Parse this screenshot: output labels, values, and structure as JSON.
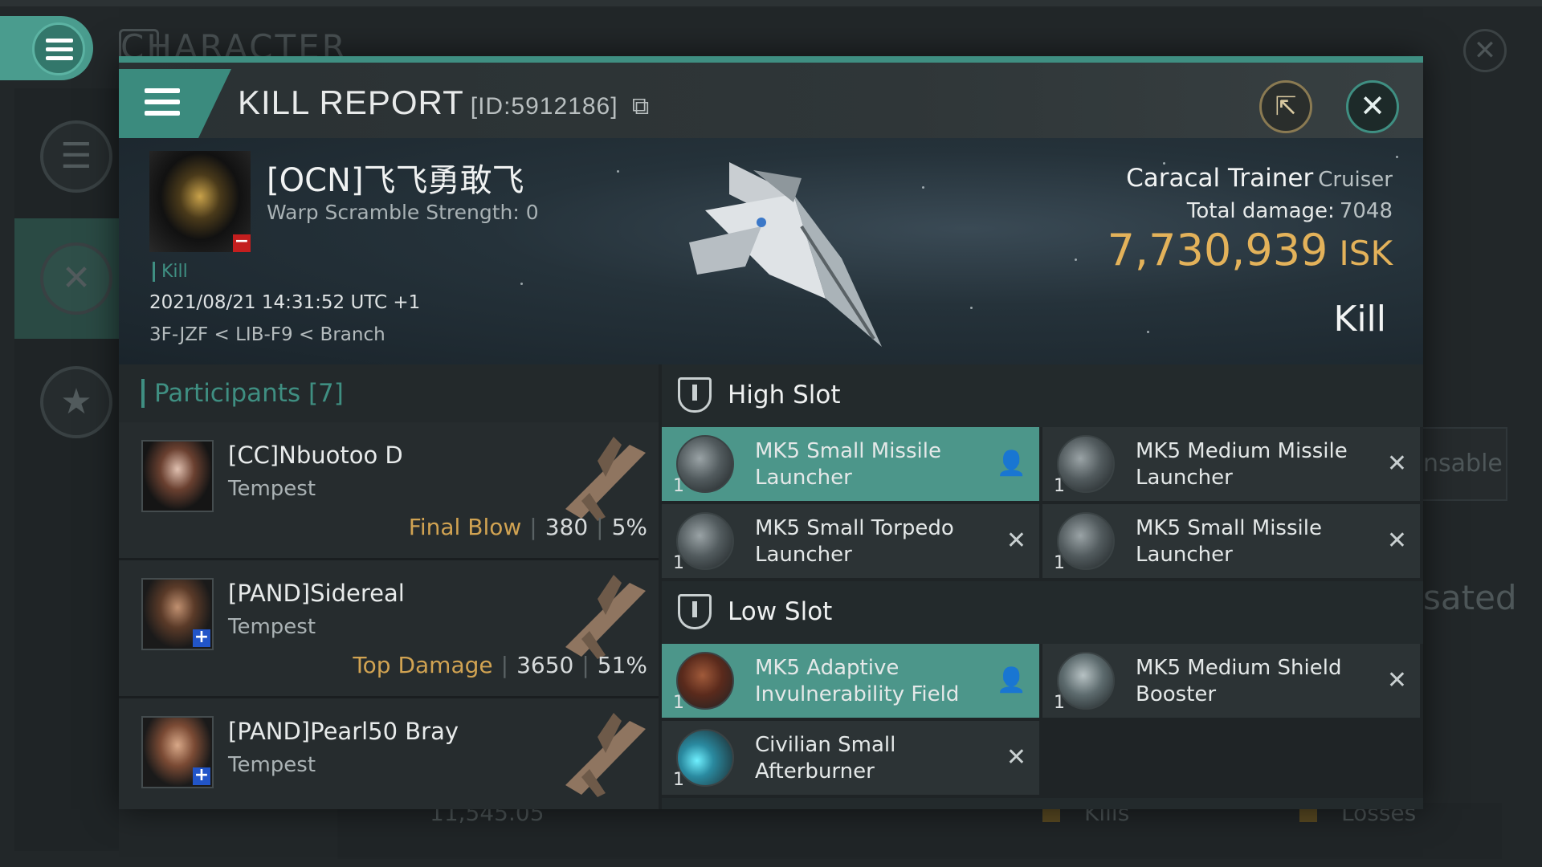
{
  "background": {
    "title": "CHARACTER",
    "side_text_1": "nsable",
    "side_text_2": "sated",
    "bottom_number": "11,545.05",
    "bottom_kills": "Kills",
    "bottom_losses": "Losses"
  },
  "header": {
    "title": "KILL REPORT",
    "id_label": "[ID:5912186]"
  },
  "victim": {
    "pilot": "[OCN]飞飞勇敢飞",
    "warp_scramble": "Warp Scramble Strength: 0",
    "tag": "Kill",
    "datetime": "2021/08/21 14:31:52 UTC +1",
    "location": "3F-JZF < LIB-F9 < Branch",
    "ship_name": "Caracal Trainer",
    "ship_class": "Cruiser",
    "total_damage_label": "Total damage:",
    "total_damage": "7048",
    "isk_value": "7,730,939",
    "isk_unit": "ISK",
    "result": "Kill"
  },
  "participants": {
    "header": "Participants [7]",
    "items": [
      {
        "name": "[CC]Nbuotoo D",
        "ship": "Tempest",
        "tag": "Final Blow",
        "damage": "380",
        "percent": "5%"
      },
      {
        "name": "[PAND]Sidereal",
        "ship": "Tempest",
        "tag": "Top Damage",
        "damage": "3650",
        "percent": "51%"
      },
      {
        "name": "[PAND]Pearl50 Bray",
        "ship": "Tempest",
        "tag": "",
        "damage": "",
        "percent": ""
      }
    ]
  },
  "fitting": {
    "high_slot": {
      "label": "High Slot",
      "modules": [
        {
          "name": "MK5 Small Missile Launcher",
          "qty": "1",
          "state": "dropped"
        },
        {
          "name": "MK5 Medium Missile Launcher",
          "qty": "1",
          "state": "destroyed"
        },
        {
          "name": "MK5 Small Torpedo Launcher",
          "qty": "1",
          "state": "destroyed"
        },
        {
          "name": "MK5 Small Missile Launcher",
          "qty": "1",
          "state": "destroyed"
        }
      ]
    },
    "low_slot": {
      "label": "Low Slot",
      "modules": [
        {
          "name": "MK5 Adaptive Invulnerability Field",
          "qty": "1",
          "state": "dropped"
        },
        {
          "name": "MK5 Medium Shield Booster",
          "qty": "1",
          "state": "destroyed"
        },
        {
          "name": "Civilian Small Afterburner",
          "qty": "1",
          "state": "destroyed"
        }
      ]
    }
  },
  "icons": {
    "menu": "hamburger-icon",
    "external": "external-link-icon",
    "close": "close-icon",
    "dropped": "person-icon",
    "destroyed": "x-icon"
  },
  "colors": {
    "accent": "#3f8f82",
    "isk": "#e3b25a",
    "tag": "#d1a352"
  }
}
